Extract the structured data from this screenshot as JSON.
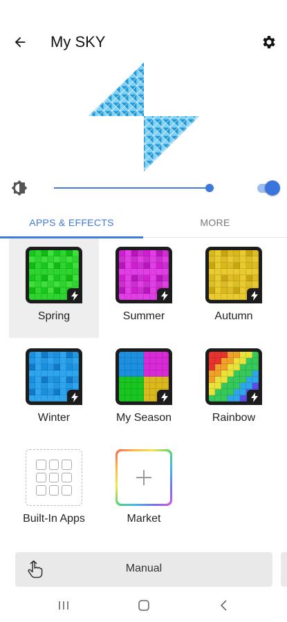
{
  "appbar": {
    "title": "My SKY",
    "back_icon": "arrow-left-icon",
    "settings_icon": "gear-icon"
  },
  "controls": {
    "brightness_icon": "brightness-icon",
    "brightness_level": 0.97,
    "power_toggle_on": true,
    "accent": "#3f7ad8"
  },
  "tabs": [
    {
      "label": "APPS & EFFECTS",
      "active": true
    },
    {
      "label": "MORE",
      "active": false
    }
  ],
  "apps": [
    {
      "label": "Spring",
      "selected": true,
      "colors": [
        "#17c81f",
        "#2ed52f",
        "#11b918",
        "#3fe03c"
      ]
    },
    {
      "label": "Summer",
      "selected": false,
      "colors": [
        "#d21ed2",
        "#e23ee6",
        "#b815bd",
        "#cc2fd0"
      ]
    },
    {
      "label": "Autumn",
      "selected": false,
      "colors": [
        "#d8b81a",
        "#e9cb30",
        "#c8a511",
        "#dcbd27"
      ]
    },
    {
      "label": "Winter",
      "selected": false,
      "colors": [
        "#1a8fe0",
        "#2ea5ee",
        "#1179c8",
        "#2497e4"
      ]
    },
    {
      "label": "My Season",
      "selected": false,
      "colors": [
        "#1d8fe0",
        "#d92ad8",
        "#19c51f",
        "#d9b91c"
      ]
    },
    {
      "label": "Rainbow",
      "selected": false,
      "colors": [
        "#e8322e",
        "#f0a12a",
        "#e9e23a",
        "#36c95a",
        "#2ea6ea",
        "#5b4de6",
        "#c73fe0"
      ]
    },
    {
      "label": "Built-In Apps",
      "selected": false
    },
    {
      "label": "Market",
      "selected": false
    }
  ],
  "manual": {
    "label": "Manual",
    "icon": "hand-pointer-icon"
  },
  "navbar": {
    "recents_icon": "recents-icon",
    "home_icon": "home-icon",
    "back_icon": "chevron-left-icon"
  }
}
